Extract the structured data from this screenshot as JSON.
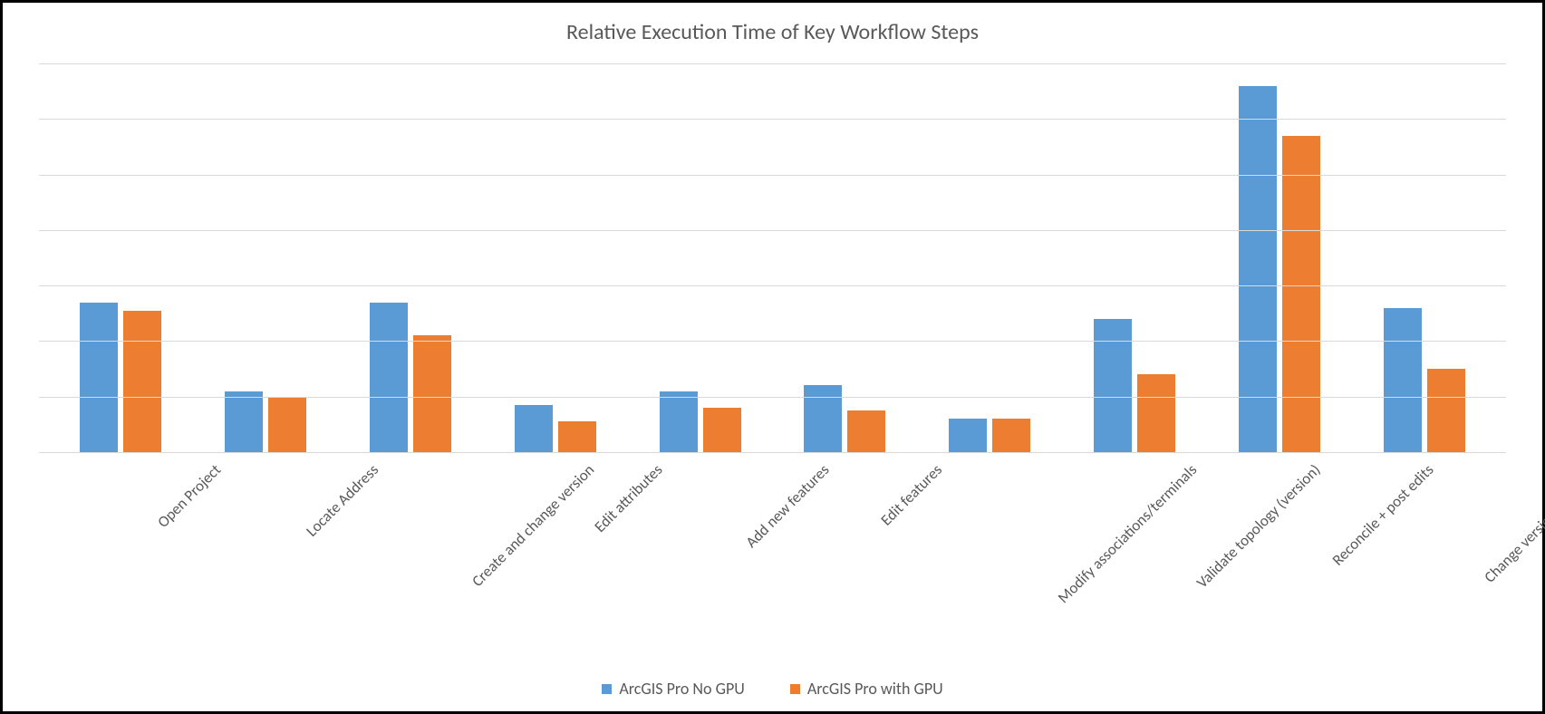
{
  "chart_data": {
    "type": "bar",
    "title": "Relative Execution Time of Key Workflow Steps",
    "xlabel": "",
    "ylabel": "",
    "ylim": [
      0,
      7
    ],
    "gridlines": [
      1,
      2,
      3,
      4,
      5,
      6,
      7
    ],
    "categories": [
      "Open Project",
      "Locate Address",
      "Create and change version",
      "Edit attributes",
      "Add new features",
      "Edit features",
      "Modify associations/terminals",
      "Validate topology (version)",
      "Reconcile + post edits",
      "Change version to default"
    ],
    "series": [
      {
        "name": "ArcGIS Pro No GPU",
        "color": "#5b9bd5",
        "values": [
          2.7,
          1.1,
          2.7,
          0.85,
          1.1,
          1.2,
          0.6,
          2.4,
          6.6,
          2.6
        ]
      },
      {
        "name": "ArcGIS Pro with GPU",
        "color": "#ed7d31",
        "values": [
          2.55,
          1.0,
          2.1,
          0.55,
          0.8,
          0.75,
          0.6,
          1.4,
          5.7,
          1.5
        ]
      }
    ],
    "legend_position": "bottom"
  }
}
